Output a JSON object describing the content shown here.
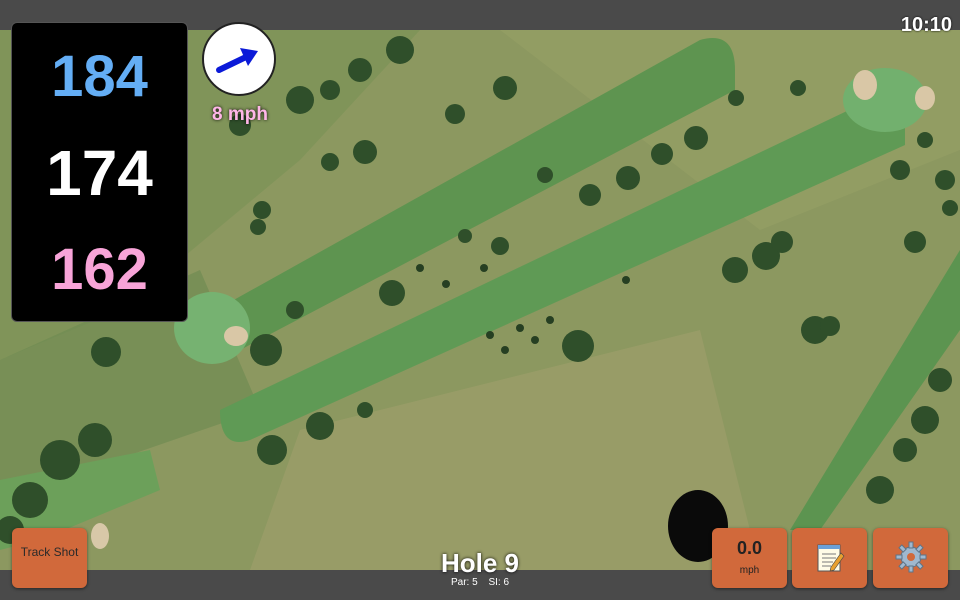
{
  "status": {
    "time": "10:10"
  },
  "distances": {
    "back": "184",
    "middle": "174",
    "front": "162"
  },
  "wind": {
    "speed": "8 mph",
    "icon": "wind-arrow-icon"
  },
  "hole": {
    "title": "Hole 9",
    "par": "Par: 5",
    "si": "SI: 6"
  },
  "buttons": {
    "track_shot": "Track Shot",
    "speed_value": "0.0",
    "speed_unit": "mph",
    "notes_icon": "notepad-icon",
    "settings_icon": "gear-icon"
  },
  "colors": {
    "back_distance": "#64aef5",
    "middle_distance": "#ffffff",
    "front_distance": "#f8a4d8",
    "button": "#d1693b",
    "wind_arrow": "#0b1ad8"
  }
}
